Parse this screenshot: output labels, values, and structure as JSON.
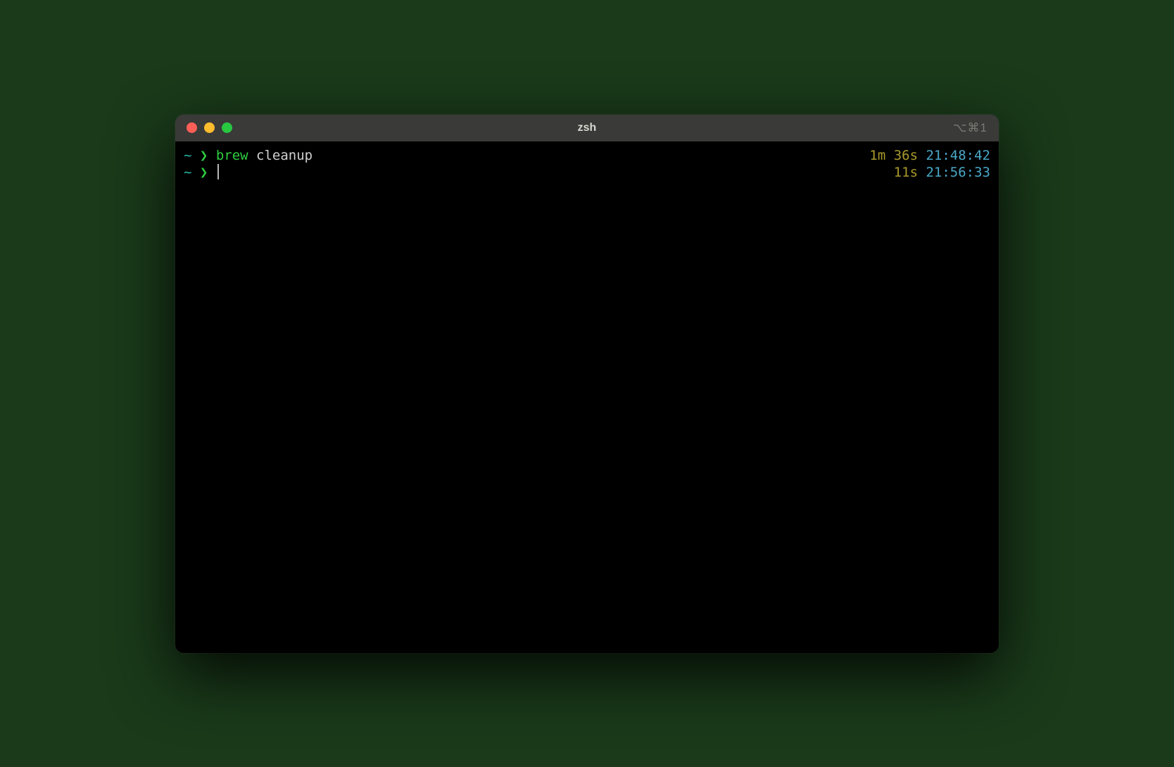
{
  "titlebar": {
    "title": "zsh",
    "right_indicator": "⌥⌘1"
  },
  "lines": [
    {
      "cwd": "~",
      "chevron": "❯",
      "cmd_head": "brew",
      "cmd_rest": " cleanup",
      "duration": "1m 36s",
      "time": "21:48:42",
      "has_cursor": false
    },
    {
      "cwd": "~",
      "chevron": "❯",
      "cmd_head": "",
      "cmd_rest": "",
      "duration": "11s",
      "time": "21:56:33",
      "has_cursor": true
    }
  ]
}
